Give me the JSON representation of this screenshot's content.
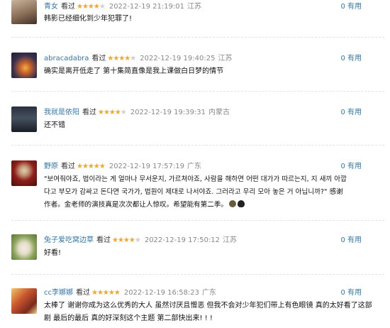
{
  "comments": [
    {
      "user": "青女",
      "watched": "看过",
      "time": "2022-12-19 21:19:01",
      "location": "江苏",
      "useful": "0 有用",
      "content": "韩影已经细化到少年犯罪了!",
      "avatar_colors": [
        "#b7a08a",
        "#4b3a2f"
      ]
    },
    {
      "user": "abracadabra",
      "watched": "看过",
      "time": "2022-12-19 19:40:25",
      "location": "江苏",
      "useful": "0 有用",
      "content": "确实是离开低走了 第十集简直像是我上课做白日梦的情节",
      "avatar_colors": [
        "#3a3a5a",
        "#d89a3c"
      ]
    },
    {
      "user": "我就是依阳",
      "watched": "看过",
      "time": "2022-12-19 19:39:31",
      "location": "内蒙古",
      "useful": "0 有用",
      "content": "还不错",
      "avatar_colors": [
        "#1d2330",
        "#5a6070"
      ]
    },
    {
      "user": "野原",
      "watched": "看过",
      "time": "2022-12-19 17:57:19",
      "location": "广东",
      "useful": "0 有用",
      "content_line1": "\"보여줘야죠, 법이라는 게 얼마나 무서운지, 가르쳐야죠, 사람을 해하면 어떤 대가가 따르는지, 지 새끼 아깝",
      "content_line2": "다고 부모가 감싸고 돈다면 국가가, 법원이 제대로 나서야죠. 그러라고 우리 모아 놓은 거 아닙니까?\" 感谢",
      "content_line3": "作者。金老师的演技真是次次都让人惊叹。希望能有第二季。",
      "avatar_colors": [
        "#8a1f1a",
        "#d9c3a8"
      ]
    },
    {
      "user": "兔子爱吃窝边草",
      "watched": "看过",
      "time": "2022-12-19 17:50:12",
      "location": "江苏",
      "useful": "0 有用",
      "content": "好看!",
      "avatar_colors": [
        "#6f8a4a",
        "#efe8d8"
      ]
    },
    {
      "user": "cc李娜娜",
      "watched": "看过",
      "time": "2022-12-19 16:58:23",
      "location": "广东",
      "useful": "0 有用",
      "content_line1": "太棒了 谢谢你成为这么优秀的大人 虽然讨厌且憎恶 但我不会对少年犯们带上有色眼镜 真的太好看了这部",
      "content_line2": "剧 最后的最后 真的好深刻这个主题 第二部快出来! ! !",
      "avatar_colors": [
        "#b0462c",
        "#f2c35a"
      ]
    }
  ],
  "ratings": [
    4,
    4,
    4,
    5,
    4,
    5
  ]
}
